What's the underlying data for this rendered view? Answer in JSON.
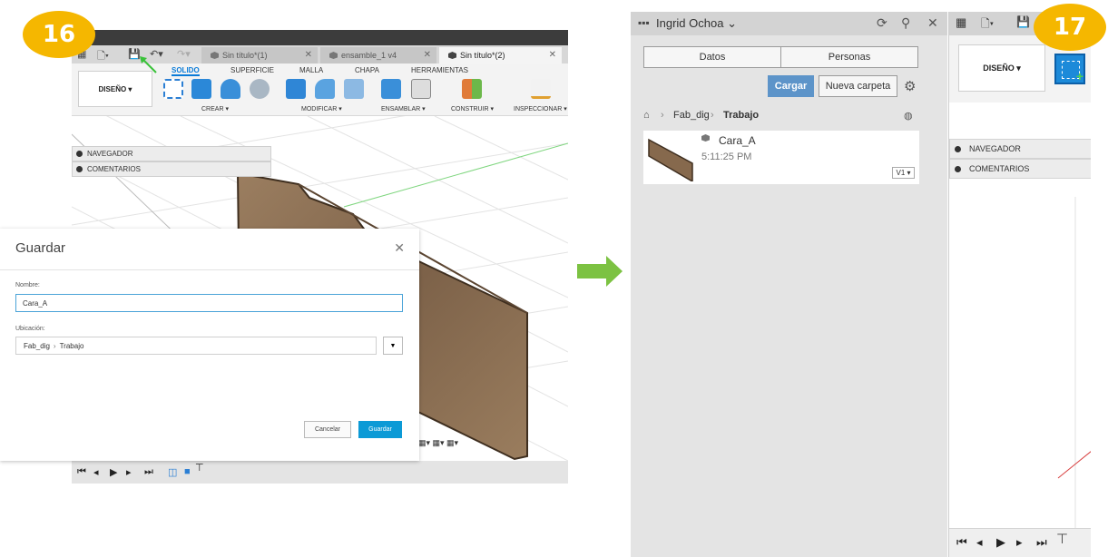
{
  "steps": {
    "left": "16",
    "right": "17"
  },
  "fusion": {
    "doc_tabs": [
      "Sin título*(1)",
      "ensamble_1 v4",
      "Sin título*(2)"
    ],
    "ribbon_tabs": [
      "SOLIDO",
      "SUPERFICIE",
      "MALLA",
      "CHAPA",
      "HERRAMIENTAS"
    ],
    "design_button": "DISEÑO ▾",
    "groups": [
      "CREAR ▾",
      "MODIFICAR ▾",
      "ENSAMBLAR ▾",
      "CONSTRUIR ▾",
      "INSPECCIONAR ▾"
    ],
    "panels": [
      "NAVEGADOR",
      "COMENTARIOS"
    ]
  },
  "save_dialog": {
    "title": "Guardar",
    "name_label": "Nombre:",
    "name_value": "Cara_A",
    "location_label": "Ubicación:",
    "location_project": "Fab_dig",
    "location_folder": "Trabajo",
    "cancel": "Cancelar",
    "save": "Guardar"
  },
  "data_panel": {
    "user": "Ingrid Ochoa",
    "tabs": [
      "Datos",
      "Personas"
    ],
    "upload": "Cargar",
    "new_folder": "Nueva carpeta",
    "breadcrumb": [
      "Fab_dig",
      "Trabajo"
    ],
    "file": {
      "name": "Cara_A",
      "time": "5:11:25 PM",
      "version": "V1 ▾"
    }
  },
  "sliver": {
    "design_button": "DISEÑO ▾",
    "panels": [
      "NAVEGADOR",
      "COMENTARIOS"
    ]
  },
  "colors": {
    "badge": "#f5b700",
    "accent": "#0a7bd8",
    "save": "#0c9ad6",
    "cargar": "#5d94c9",
    "arrow": "#7cc242",
    "wood": "#8b6e52"
  }
}
